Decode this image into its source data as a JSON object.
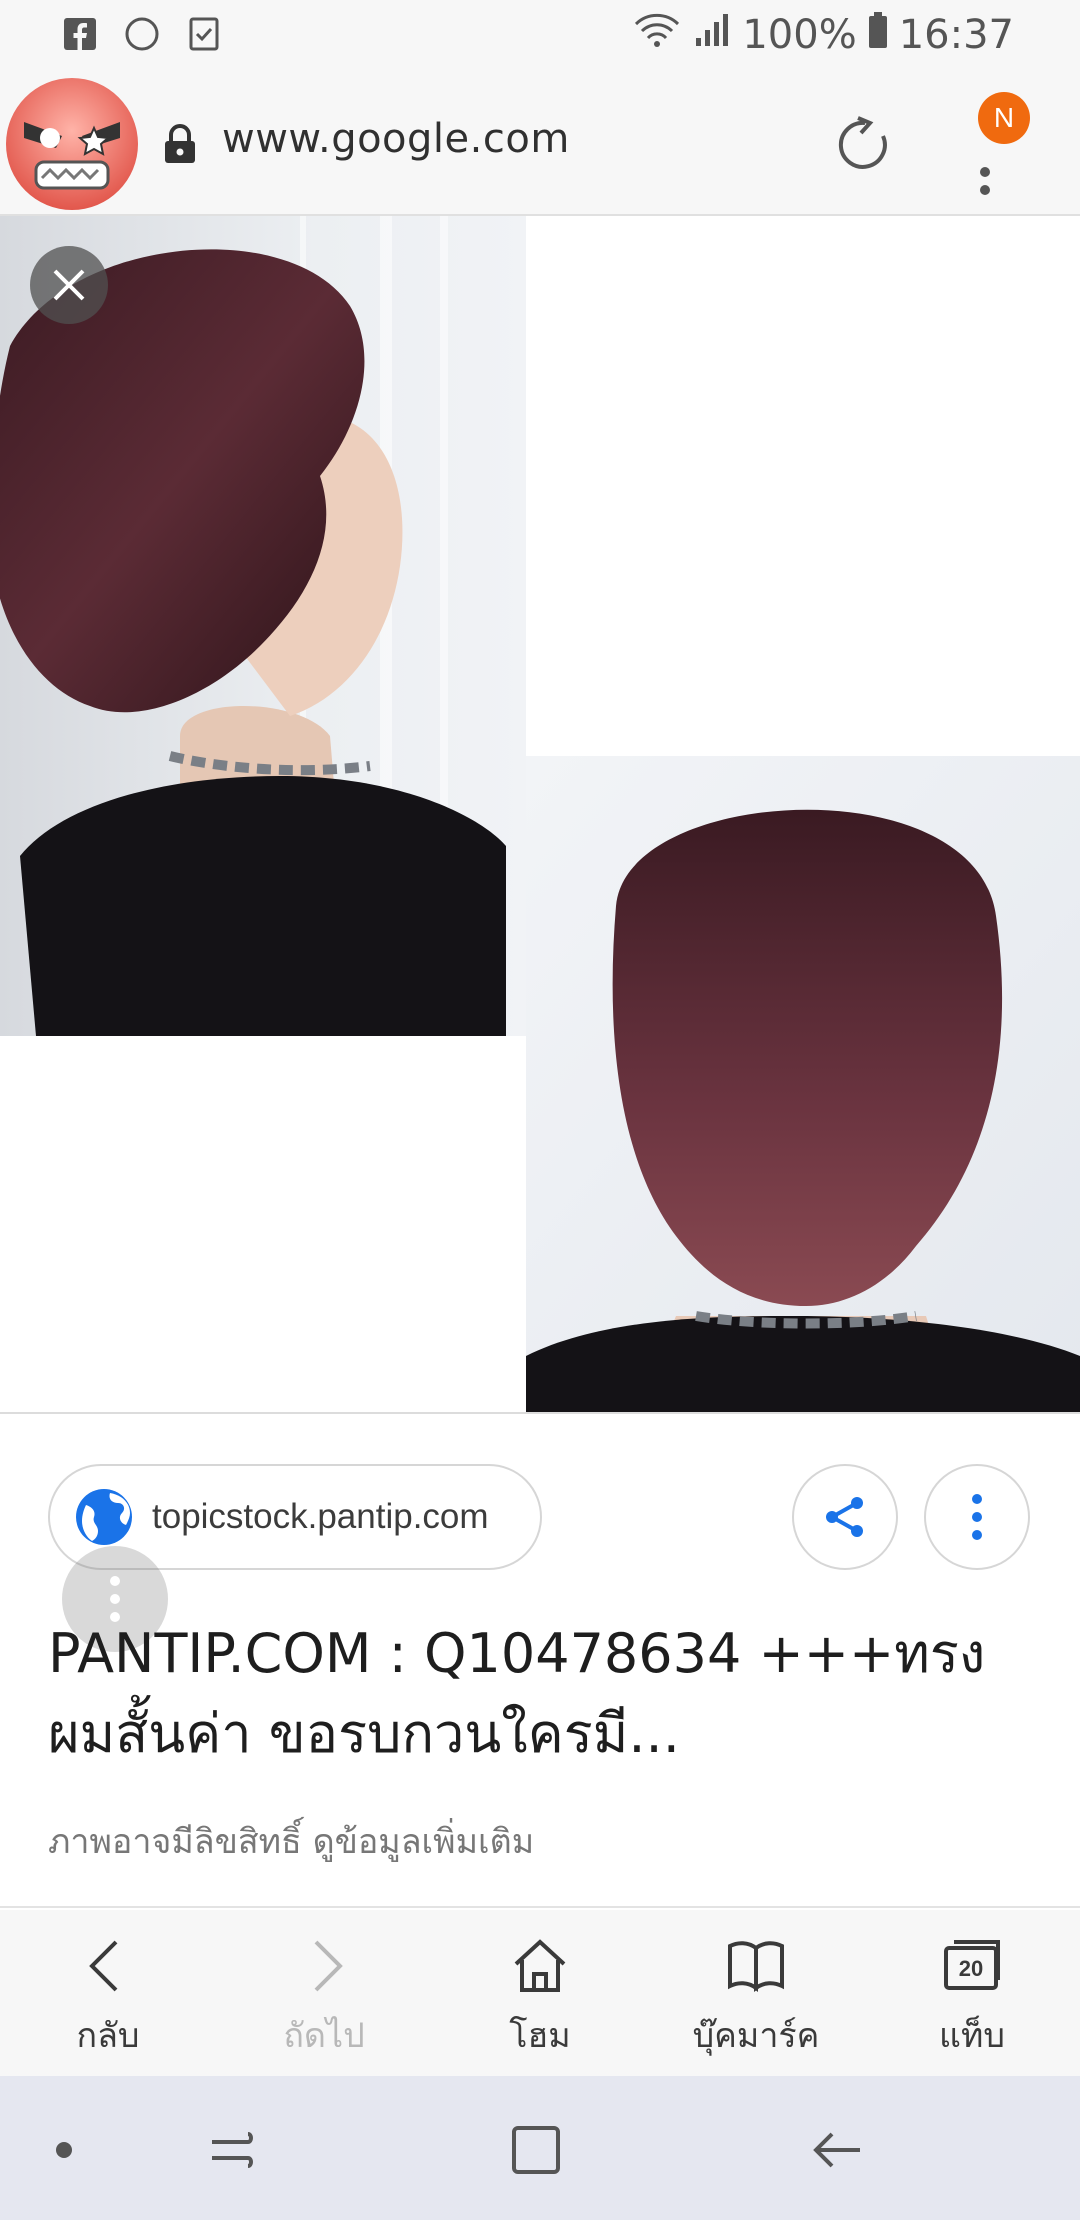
{
  "status_bar": {
    "left_icons": [
      "facebook-icon",
      "circle-icon",
      "task-icon"
    ],
    "battery": "100%",
    "time": "16:37"
  },
  "address_bar": {
    "url": "www.google.com",
    "badge": "N"
  },
  "source": {
    "domain": "topicstock.pantip.com"
  },
  "result": {
    "title": "PANTIP.COM : Q10478634 +++ทรงผมสั้นค่า ขอรบกวนใครมี...",
    "copyright_note": "ภาพอาจมีลิขสิทธิ์ ดูข้อมูลเพิ่มเติม"
  },
  "browser_nav": [
    {
      "label": "กลับ",
      "icon": "back-chevron-icon",
      "enabled": true
    },
    {
      "label": "ถัดไป",
      "icon": "forward-chevron-icon",
      "enabled": false
    },
    {
      "label": "โฮม",
      "icon": "home-icon",
      "enabled": true
    },
    {
      "label": "บุ๊คมาร์ค",
      "icon": "bookmark-icon",
      "enabled": true
    },
    {
      "label": "แท็บ",
      "icon": "tabs-icon",
      "enabled": true,
      "count": "20"
    }
  ],
  "colors": {
    "accent_blue": "#1a73e8",
    "badge_orange": "#f06a0f",
    "bar_background": "#f7f7f7",
    "system_nav_background": "#e5e7f0"
  }
}
